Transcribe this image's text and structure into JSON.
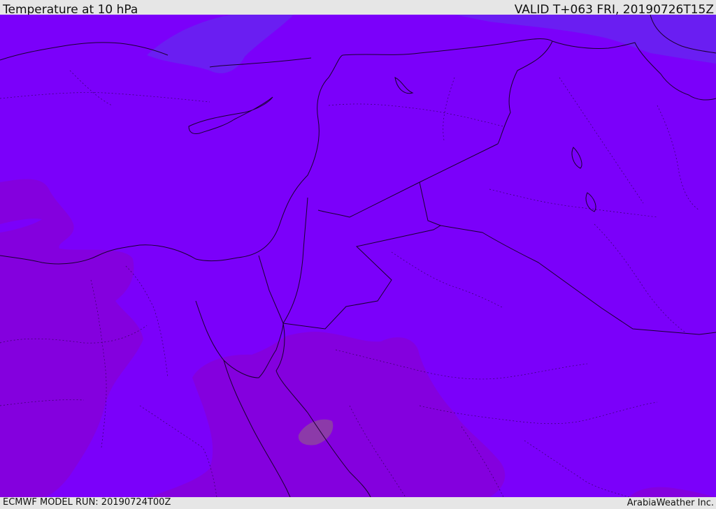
{
  "header": {
    "title": "Temperature at 10 hPa",
    "valid": "VALID T+063 FRI, 20190726T15Z"
  },
  "footer": {
    "model_run": "ECMWF MODEL RUN: 20190724T00Z",
    "provider": "ArabiaWeather Inc."
  },
  "map": {
    "colors": {
      "base": "#7b00fa",
      "cool_band": "#6a1ef2",
      "warm_band": "#8400de",
      "warm_spot": "#8c3aa9",
      "border": "#1a0030"
    }
  }
}
